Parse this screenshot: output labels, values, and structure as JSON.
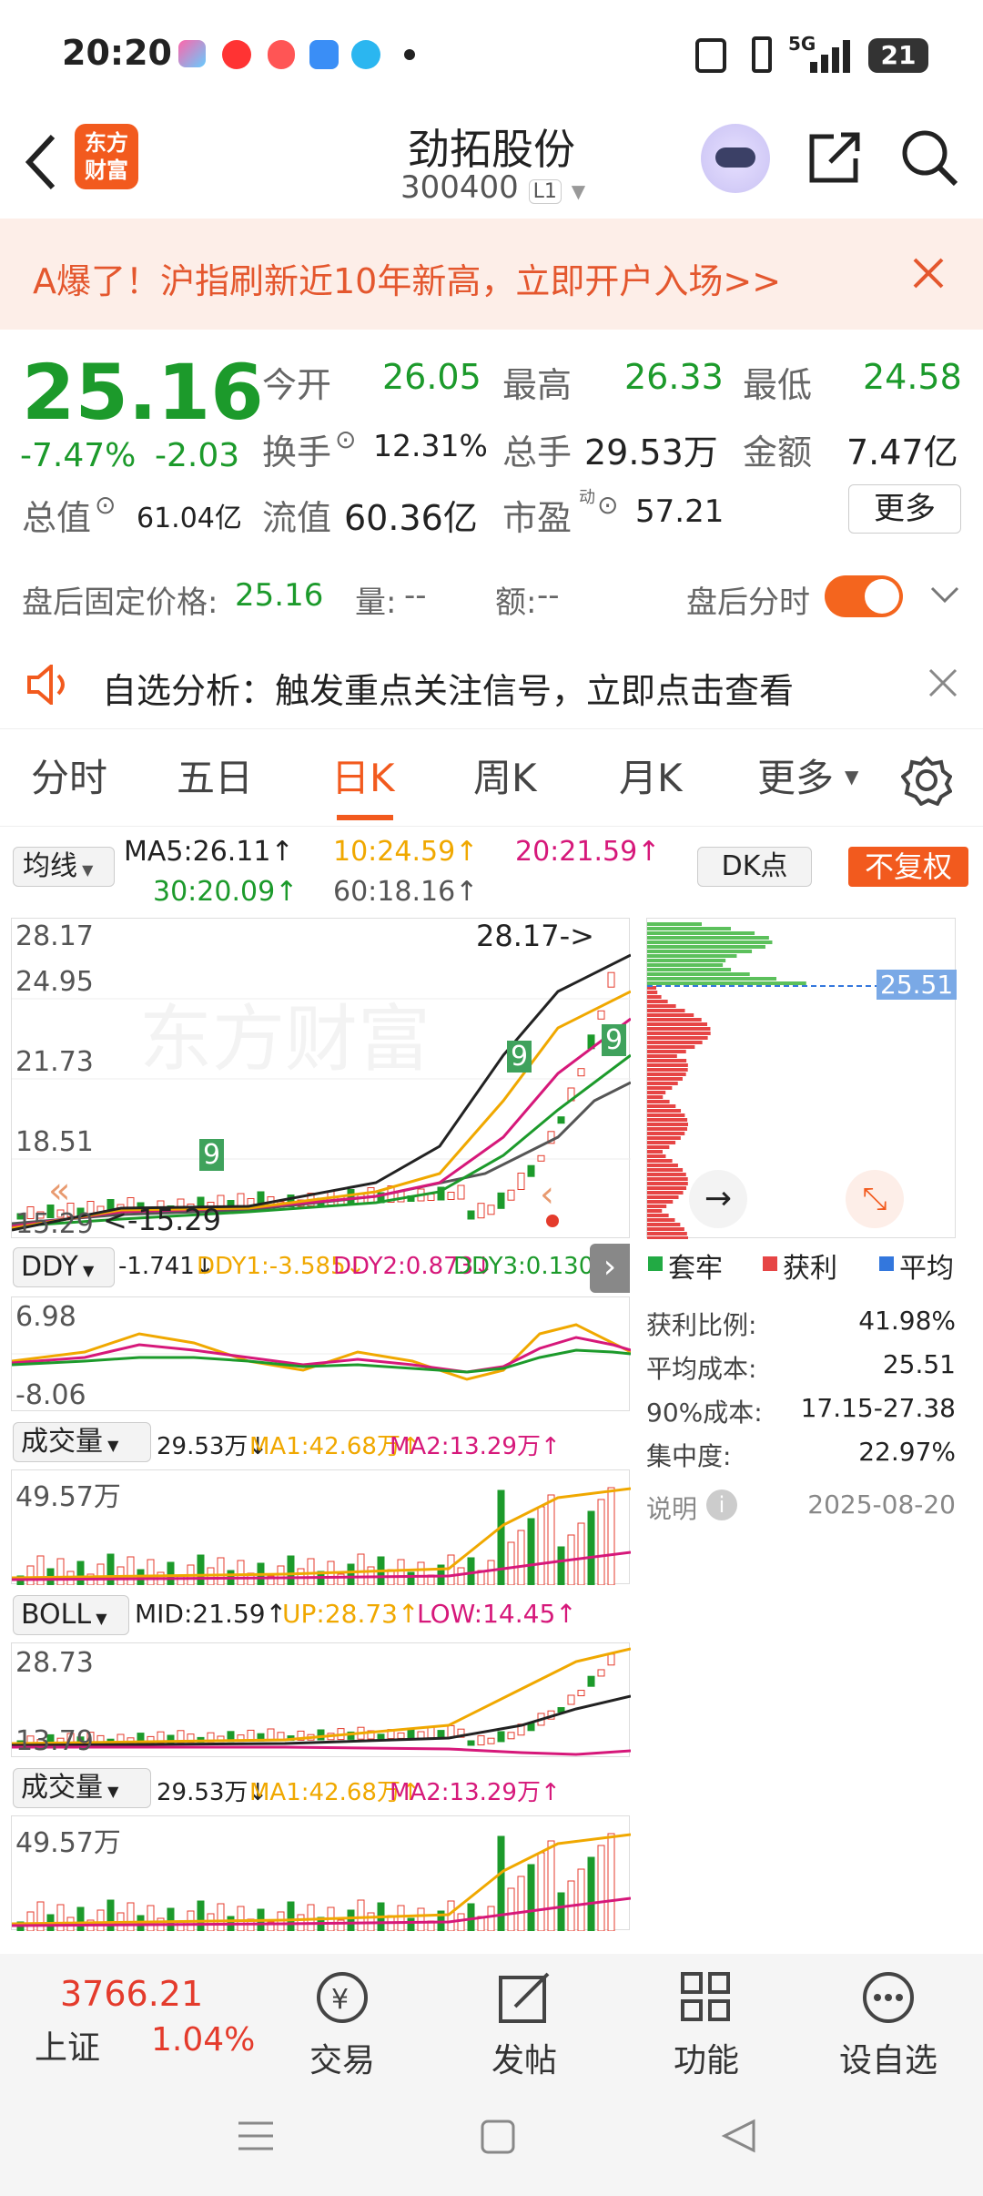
{
  "status_bar": {
    "time": "20:20",
    "battery": "21",
    "signal": "5G"
  },
  "header": {
    "logo_line1": "东方",
    "logo_line2": "财富",
    "stock_name": "劲拓股份",
    "stock_code": "300400",
    "level": "L1"
  },
  "banner": {
    "text": "A爆了！沪指刷新近10年新高，立即开户入场>>"
  },
  "quote": {
    "price": "25.16",
    "change_pct": "-7.47%",
    "change": "-2.03",
    "open_label": "今开",
    "open": "26.05",
    "high_label": "最高",
    "high": "26.33",
    "low_label": "最低",
    "low": "24.58",
    "turnover_label": "换手",
    "turnover": "12.31%",
    "volume_label": "总手",
    "volume": "29.53万",
    "amount_label": "金额",
    "amount": "7.47亿",
    "mktcap_label": "总值",
    "mktcap": "61.04亿",
    "float_label": "流值",
    "float": "60.36亿",
    "pe_label": "市盈",
    "pe_sup": "动",
    "pe": "57.21",
    "more": "更多"
  },
  "after_hours": {
    "label": "盘后固定价格:",
    "price": "25.16",
    "vol_label": "量:",
    "vol": "--",
    "amt_label": "额:",
    "amt": "--",
    "toggle_label": "盘后分时"
  },
  "notice": {
    "text": "自选分析：触发重点关注信号，立即点击查看"
  },
  "tabs": [
    {
      "label": "分时"
    },
    {
      "label": "五日"
    },
    {
      "label": "日K"
    },
    {
      "label": "周K"
    },
    {
      "label": "月K"
    },
    {
      "label": "更多"
    }
  ],
  "ma": {
    "selector": "均线",
    "ma5": "MA5:26.11↑",
    "ma10": "10:24.59↑",
    "ma20": "20:21.59↑",
    "ma30": "30:20.09↑",
    "ma60": "60:18.16↑",
    "dk": "DK点",
    "fq": "不复权"
  },
  "kline": {
    "y1": "28.17",
    "y2": "24.95",
    "y3": "21.73",
    "y4": "18.51",
    "y5": "15.29",
    "high_mark": "28.17->",
    "low_mark": "<-15.29",
    "nine1": "9",
    "nine2": "9",
    "nine3": "9"
  },
  "chip": {
    "price_tag": "25.51",
    "legend": [
      {
        "label": "套牢",
        "color": "#22aa44"
      },
      {
        "label": "获利",
        "color": "#e64545"
      },
      {
        "label": "平均",
        "color": "#3377dd"
      }
    ],
    "rows": [
      {
        "label": "获利比例:",
        "value": "41.98%"
      },
      {
        "label": "平均成本:",
        "value": "25.51"
      },
      {
        "label": "90%成本:",
        "value": "17.15-27.38"
      },
      {
        "label": "集中度:",
        "value": "22.97%"
      }
    ],
    "note": "说明",
    "date": "2025-08-20"
  },
  "ddy": {
    "name": "DDY",
    "v0": "-1.741↓",
    "v1": "DDY1:-3.585↓",
    "v2": "DDY2:0.873↓",
    "v3": "DDY3:0.130↓",
    "top": "6.98",
    "bottom": "-8.06"
  },
  "vol1": {
    "name": "成交量",
    "v0": "29.53万↓",
    "ma1": "MA1:42.68万↑",
    "ma2": "MA2:13.29万↑",
    "top": "49.57万"
  },
  "boll": {
    "name": "BOLL",
    "mid": "MID:21.59↑",
    "up": "UP:28.73↑",
    "low": "LOW:14.45↑",
    "top": "28.73",
    "bottom": "13.79"
  },
  "vol2": {
    "name": "成交量",
    "v0": "29.53万↓",
    "ma1": "MA1:42.68万↑",
    "ma2": "MA2:13.29万↑",
    "top": "49.57万"
  },
  "bottom_nav": {
    "index_value": "3766.21",
    "index_name": "上证",
    "index_pct": "1.04%",
    "items": [
      {
        "label": "交易"
      },
      {
        "label": "发帖"
      },
      {
        "label": "功能"
      },
      {
        "label": "设自选"
      }
    ]
  }
}
